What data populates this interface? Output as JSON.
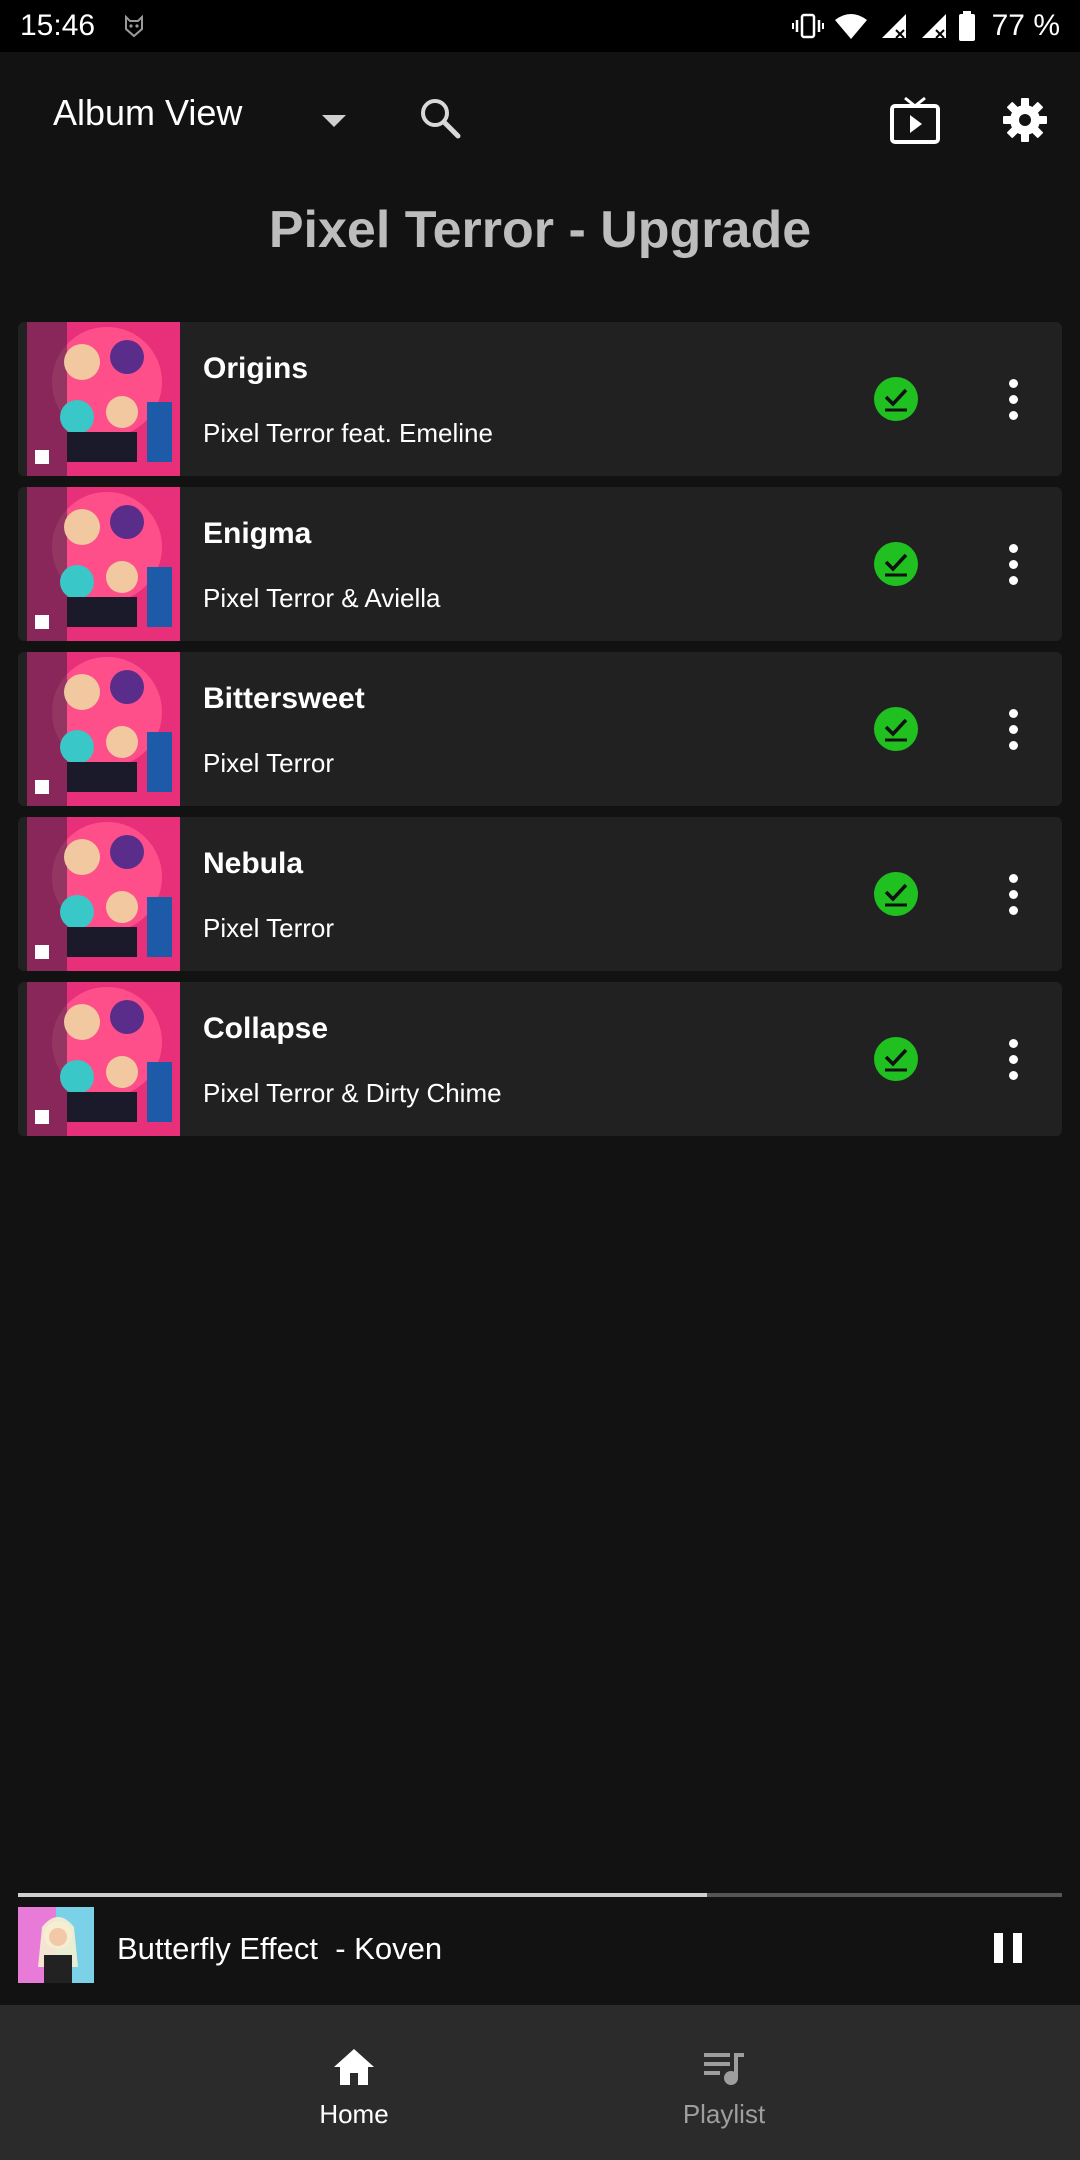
{
  "status_bar": {
    "time": "15:46",
    "battery": "77 %"
  },
  "app_bar": {
    "view_selector": "Album View",
    "icons": [
      "search-icon",
      "cast-tv-icon",
      "gear-icon"
    ]
  },
  "album": {
    "title": "Pixel Terror - Upgrade"
  },
  "tracks": [
    {
      "title": "Origins",
      "artist": "Pixel Terror feat. Emeline"
    },
    {
      "title": "Enigma",
      "artist": "Pixel Terror & Aviella"
    },
    {
      "title": "Bittersweet",
      "artist": "Pixel Terror"
    },
    {
      "title": "Nebula",
      "artist": "Pixel Terror"
    },
    {
      "title": "Collapse",
      "artist": "Pixel Terror & Dirty Chime"
    }
  ],
  "now_playing": {
    "title": "Butterfly Effect  - Koven",
    "progress": 0.66
  },
  "bottom_nav": {
    "home_label": "Home",
    "playlist_label": "Playlist"
  },
  "colors": {
    "background": "#121212",
    "row_background": "#212121",
    "downloaded": "#1fc01f",
    "nav_background": "#2b2b2b"
  }
}
